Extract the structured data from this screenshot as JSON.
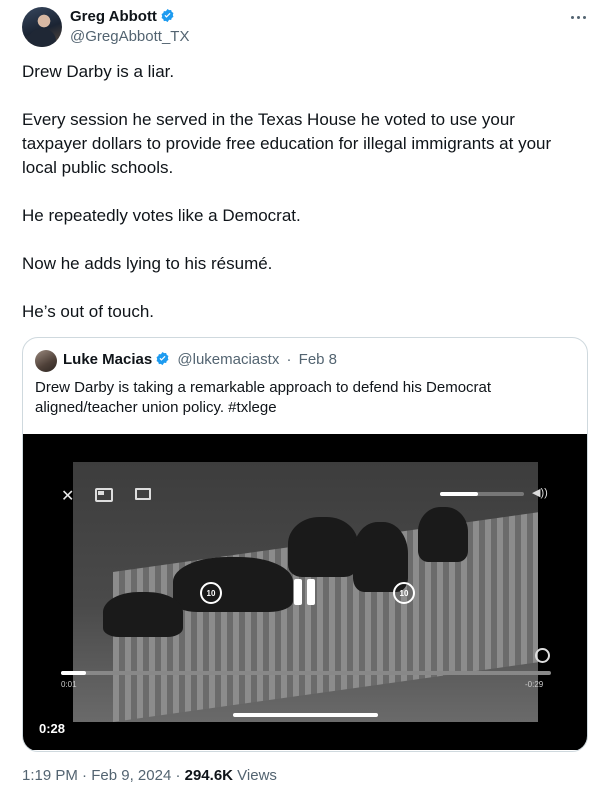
{
  "author": {
    "name": "Greg Abbott",
    "handle": "@GregAbbott_TX",
    "verified_icon": "verified-badge-icon"
  },
  "tweet": {
    "paragraphs": [
      "Drew Darby is a liar.",
      "Every session he served in the Texas House he voted to use your taxpayer dollars to provide free education for illegal immigrants at your local public schools.",
      "He repeatedly votes like a Democrat.",
      "Now he adds lying to his résumé.",
      "He’s out of touch."
    ]
  },
  "quoted_tweet": {
    "name": "Luke Macias",
    "handle": "@lukemaciastx",
    "separator": "·",
    "date": "Feb 8",
    "text": "Drew Darby is taking a remarkable approach to defend his Democrat aligned/teacher union policy. #txlege",
    "video": {
      "elapsed": "0:01",
      "remaining": "-0:29",
      "duration_badge": "0:28",
      "skip_back_label": "10",
      "skip_forward_label": "10",
      "progress_fraction": 0.05,
      "volume_fraction": 0.45
    }
  },
  "footer": {
    "time": "1:19 PM",
    "separator": "·",
    "date": "Feb 9, 2024",
    "views_count": "294.6K",
    "views_label": "Views"
  },
  "colors": {
    "text_primary": "#0f1419",
    "text_secondary": "#536471",
    "verified_blue": "#1d9bf0",
    "border": "#cfd9de"
  }
}
